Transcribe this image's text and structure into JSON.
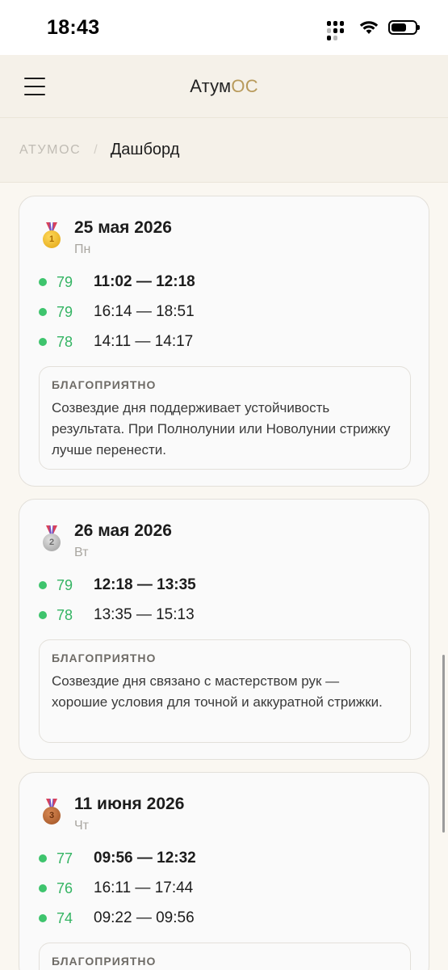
{
  "status_bar": {
    "time": "18:43"
  },
  "header": {
    "brand_main": "Атум",
    "brand_accent": "ОС"
  },
  "breadcrumb": {
    "root": "АТУМОС",
    "separator": "/",
    "current": "Дашборд"
  },
  "days": [
    {
      "date": "25 мая 2026",
      "weekday": "Пн",
      "medal": "gold-medal-1",
      "slots": [
        {
          "score": "79",
          "range": "11:02 — 12:18"
        },
        {
          "score": "79",
          "range": "16:14 — 18:51"
        },
        {
          "score": "78",
          "range": "14:11 — 14:17"
        }
      ],
      "note_label": "БЛАГОПРИЯТНО",
      "note_text": "Созвездие дня поддерживает устойчивость результата. При Полнолунии или Новолунии стрижку лучше перенести."
    },
    {
      "date": "26 мая 2026",
      "weekday": "Вт",
      "medal": "silver-medal-2",
      "slots": [
        {
          "score": "79",
          "range": "12:18 — 13:35"
        },
        {
          "score": "78",
          "range": "13:35 — 15:13"
        }
      ],
      "note_label": "БЛАГОПРИЯТНО",
      "note_text": "Созвездие дня связано с мастерством рук — хорошие условия для точной и аккуратной стрижки."
    },
    {
      "date": "11 июня 2026",
      "weekday": "Чт",
      "medal": "bronze-medal-3",
      "slots": [
        {
          "score": "77",
          "range": "09:56 — 12:32"
        },
        {
          "score": "76",
          "range": "16:11 — 17:44"
        },
        {
          "score": "74",
          "range": "09:22 — 09:56"
        }
      ],
      "note_label": "БЛАГОПРИЯТНО"
    }
  ],
  "colors": {
    "accent": "#b89a5b",
    "score_green": "#34b463",
    "dot_green": "#3ec46d",
    "background": "#faf7f1"
  }
}
